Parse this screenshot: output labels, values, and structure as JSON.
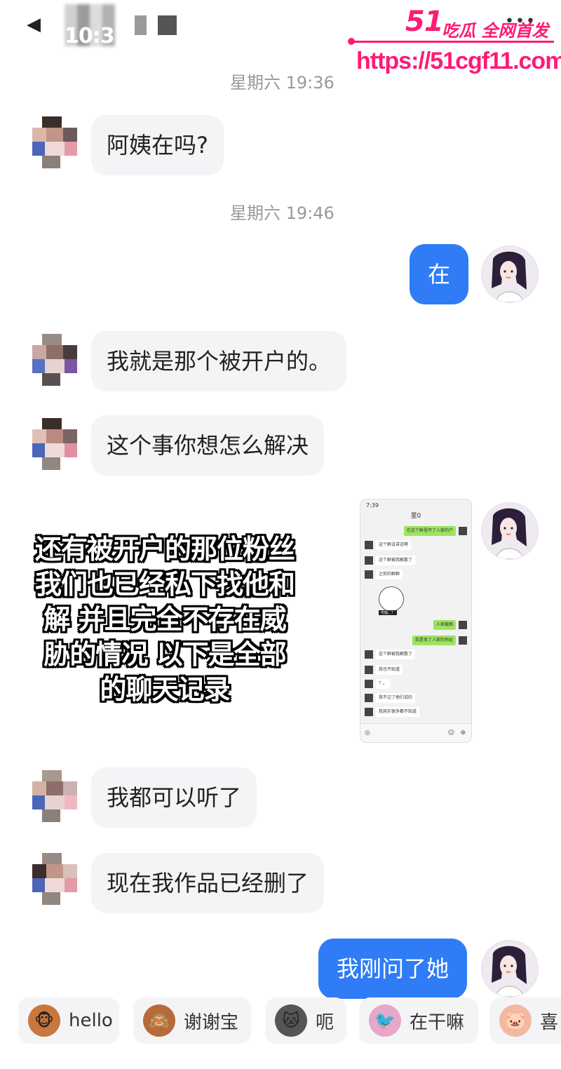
{
  "status_bar": {
    "time": "10:3"
  },
  "watermark": {
    "brand_number": "51",
    "brand_text": "吃瓜 全网首发",
    "url": "https://51cgf11.com"
  },
  "timestamps": [
    "星期六 19:36",
    "星期六 19:46"
  ],
  "messages": [
    {
      "side": "left",
      "text": "阿姨在吗?"
    },
    {
      "side": "right",
      "text": "在"
    },
    {
      "side": "left",
      "text": "我就是那个被开户的。"
    },
    {
      "side": "left",
      "text": "这个事你想怎么解决"
    },
    {
      "side": "left",
      "text": "我都可以听了"
    },
    {
      "side": "left",
      "text": "现在我作品已经删了"
    },
    {
      "side": "right",
      "text": "我刚问了她"
    }
  ],
  "overlay_caption": [
    "还有被开户的那位粉丝",
    "我们也已经私下找他和",
    "解 并且完全不存在威",
    "胁的情况 以下是全部",
    "的聊天记录"
  ],
  "embedded_screenshot": {
    "time": "7:39",
    "title": "里0",
    "rows": [
      {
        "side": "right",
        "text": "在这个群里开了人家的户"
      },
      {
        "side": "left",
        "text": "这个群没讲话啊"
      },
      {
        "side": "left",
        "text": "这个群被我解散了"
      },
      {
        "side": "left",
        "text": "之前的群聊"
      },
      {
        "side": "right",
        "text": "人家截图"
      },
      {
        "side": "right",
        "text": "我是发了人家的地址"
      },
      {
        "side": "left",
        "text": "这个群被我解散了"
      },
      {
        "side": "left",
        "text": "我也不知道"
      },
      {
        "side": "left",
        "text": "？。"
      },
      {
        "side": "left",
        "text": "我不记了他们说的"
      },
      {
        "side": "left",
        "text": "我其实很多都不知道"
      }
    ],
    "sticker_label": "可能。？"
  },
  "quick_replies": [
    {
      "label": "hello",
      "icon": "monkey-icon",
      "color": "#c9773c"
    },
    {
      "label": "谢谢宝",
      "icon": "monkey-flower-icon",
      "color": "#b86b3a"
    },
    {
      "label": "呃",
      "icon": "cat-icon",
      "color": "#555555"
    },
    {
      "label": "在干嘛",
      "icon": "bird-face-icon",
      "color": "#e5a8c8"
    },
    {
      "label": "喜",
      "icon": "pig-face-icon",
      "color": "#f3b8a0"
    }
  ],
  "colors": {
    "accent_blue": "#2f7cf6",
    "bubble_grey": "#f3f4f6",
    "watermark_pink": "#ff1a75"
  }
}
